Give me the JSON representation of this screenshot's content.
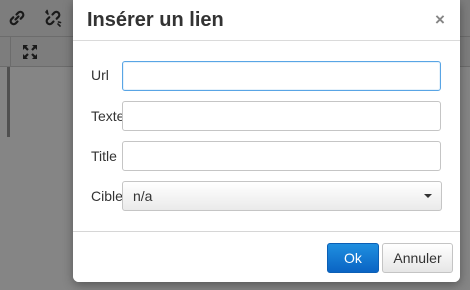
{
  "dialog": {
    "title": "Insérer un lien",
    "close_symbol": "×",
    "fields": {
      "url": {
        "label": "Url",
        "value": ""
      },
      "text": {
        "label": "Texte",
        "value": ""
      },
      "title": {
        "label": "Title",
        "value": ""
      },
      "target": {
        "label": "Cible",
        "selected": "n/a"
      }
    },
    "buttons": {
      "ok": "Ok",
      "cancel": "Annuler"
    }
  },
  "colors": {
    "primary_button": "#1a7fd8",
    "focus_border": "#59a5e5",
    "overlay": "#000000"
  },
  "icons": [
    "link-icon",
    "unlink-icon",
    "fullscreen-icon",
    "close-icon",
    "dropdown-arrow-icon"
  ]
}
